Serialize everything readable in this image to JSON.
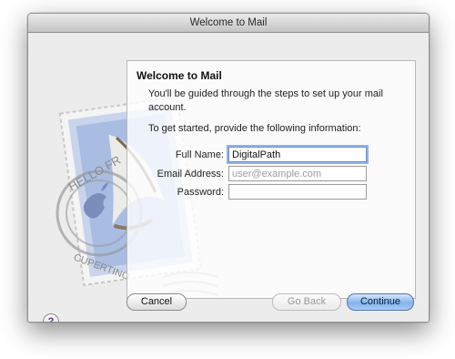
{
  "window": {
    "title": "Welcome to Mail"
  },
  "stamp": {
    "postmark_lines": [
      "HELLO FR",
      "CUPERTINO"
    ]
  },
  "panel": {
    "heading": "Welcome to Mail",
    "intro": "You'll be guided through the steps to set up your mail account.",
    "prompt": "To get started, provide the following information:"
  },
  "form": {
    "full_name": {
      "label": "Full Name:",
      "value": "DigitalPath"
    },
    "email": {
      "label": "Email Address:",
      "placeholder": "user@example.com",
      "value": ""
    },
    "password": {
      "label": "Password:",
      "value": ""
    }
  },
  "buttons": {
    "help": "?",
    "cancel": "Cancel",
    "go_back": "Go Back",
    "continue": "Continue"
  },
  "colors": {
    "default_button": "#84b2ec",
    "focus_ring": "#8fb3ec",
    "stamp_paper": "#c7d4ec"
  }
}
